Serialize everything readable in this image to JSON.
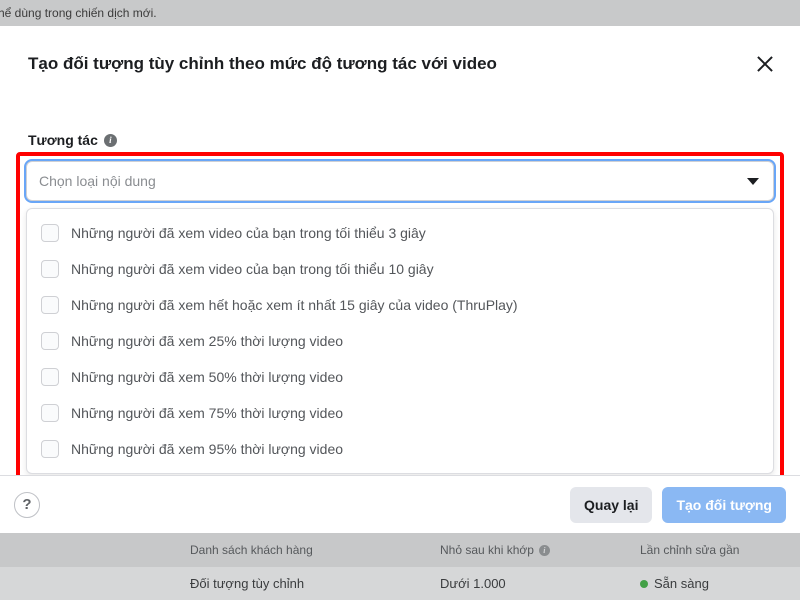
{
  "background": {
    "top_notice": "hể dùng trong chiến dịch mới.",
    "table": {
      "head": {
        "colA": "Danh sách khách hàng",
        "colB": "Nhỏ sau khi khớp",
        "colC": "Lần chỉnh sửa gần"
      },
      "row": {
        "name": "Đối tượng tùy chỉnh",
        "size": "Dưới 1.000",
        "status": "Sẵn sàng"
      }
    }
  },
  "modal": {
    "title": "Tạo đối tượng tùy chỉnh theo mức độ tương tác với video",
    "section_label": "Tương tác",
    "select_placeholder": "Chọn loại nội dung",
    "options": [
      "Những người đã xem video của bạn trong tối thiểu 3 giây",
      "Những người đã xem video của bạn trong tối thiểu 10 giây",
      "Những người đã xem hết hoặc xem ít nhất 15 giây của video (ThruPlay)",
      "Những người đã xem 25% thời lượng video",
      "Những người đã xem 50% thời lượng video",
      "Những người đã xem 75% thời lượng video",
      "Những người đã xem 95% thời lượng video"
    ],
    "footer": {
      "help": "?",
      "back": "Quay lại",
      "create": "Tạo đối tượng"
    }
  }
}
